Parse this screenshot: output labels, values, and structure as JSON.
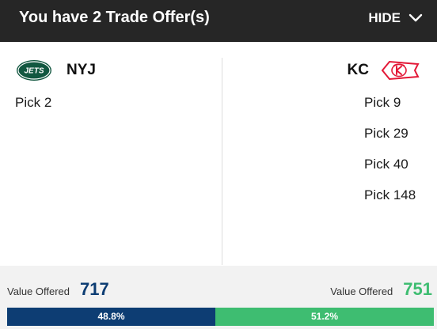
{
  "header": {
    "title": "You have 2 Trade Offer(s)",
    "hide_label": "HIDE",
    "hide_icon": "chevron-down-icon"
  },
  "left_team": {
    "abbr": "NYJ",
    "logo_text": "JETS",
    "logo_color": "#125740",
    "picks": [
      "Pick 2"
    ]
  },
  "right_team": {
    "abbr": "KC",
    "logo_color": "#e31837",
    "picks": [
      "Pick 9",
      "Pick 29",
      "Pick 40",
      "Pick 148"
    ]
  },
  "value": {
    "left_label": "Value Offered",
    "left_value": "717",
    "right_label": "Value Offered",
    "right_value": "751",
    "left_percent_label": "48.8%",
    "right_percent_label": "51.2%",
    "left_share": 0.488,
    "right_share": 0.512,
    "left_color": "#0d3d73",
    "right_color": "#3ebd71"
  }
}
